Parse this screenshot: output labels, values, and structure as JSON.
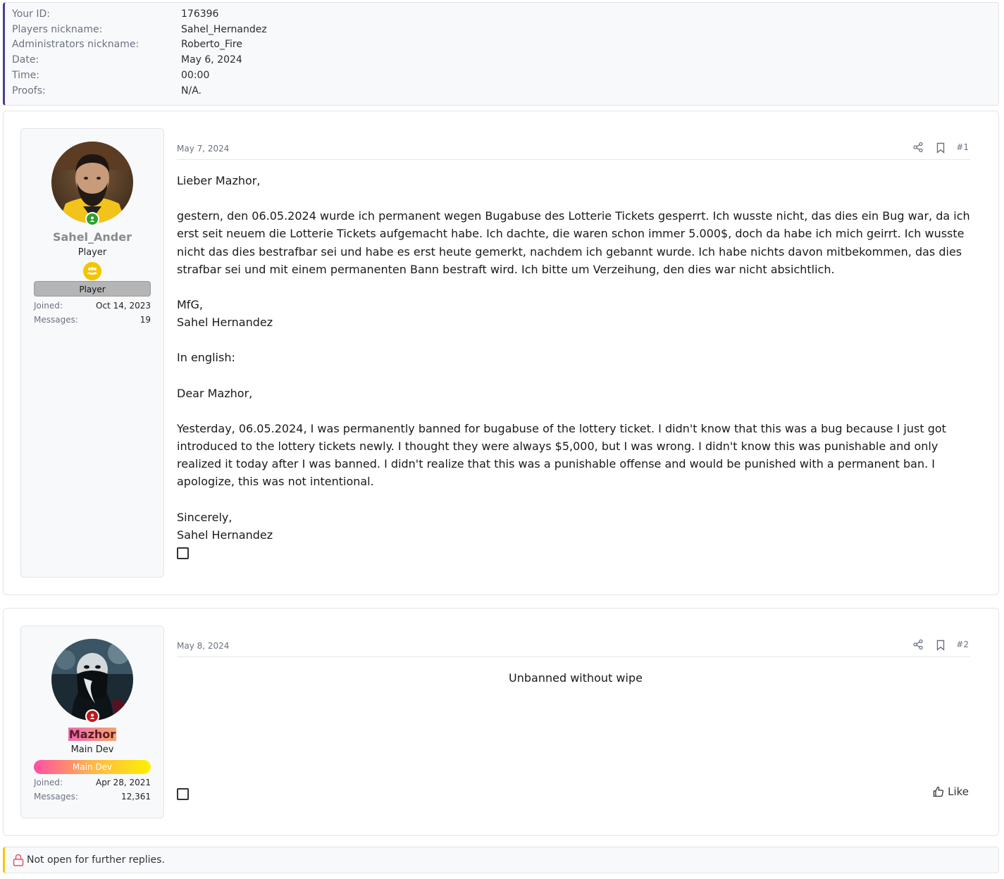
{
  "info": {
    "rows": [
      {
        "label": "Your ID:",
        "value": "176396"
      },
      {
        "label": "Players nickname:",
        "value": "Sahel_Hernandez"
      },
      {
        "label": "Administrators nickname:",
        "value": "Roberto_Fire"
      },
      {
        "label": "Date:",
        "value": "May 6, 2024"
      },
      {
        "label": "Time:",
        "value": "00:00"
      },
      {
        "label": "Proofs:",
        "value": "N/A."
      }
    ]
  },
  "posts": [
    {
      "username": "Sahel_Ander",
      "user_title": "Player",
      "banner": "Player",
      "joined_label": "Joined:",
      "joined": "Oct 14, 2023",
      "messages_label": "Messages:",
      "messages": "19",
      "date": "May 7, 2024",
      "number": "#1",
      "body": [
        "Lieber Mazhor,",
        "gestern, den 06.05.2024 wurde ich permanent wegen Bugabuse des Lotterie Tickets gesperrt. Ich wusste nicht, das dies ein Bug war, da ich erst seit neuem die Lotterie Tickets aufgemacht habe. Ich dachte, die waren schon immer 5.000$, doch da habe ich mich geirrt. Ich wusste nicht das dies bestrafbar sei und habe es erst heute gemerkt, nachdem ich gebannt wurde. Ich habe nichts davon mitbekommen, das dies strafbar sei und mit einem permanenten Bann bestraft wird. Ich bitte um Verzeihung, den dies war nicht absichtlich.",
        "MfG,\nSahel Hernandez",
        "In english:",
        "Dear Mazhor,",
        "Yesterday, 06.05.2024, I was permanently banned for bugabuse of the lottery ticket. I didn't know that this was a bug because I just got introduced to the lottery tickets newly. I thought they were always $5,000, but I was wrong. I didn't know this was punishable and only realized it today after I was banned. I didn't realize that this was a punishable offense and would be punished with a permanent ban. I apologize, this was not intentional.",
        "Sincerely,\nSahel Hernandez"
      ]
    },
    {
      "username": "Mazhor",
      "user_title": "Main Dev",
      "banner": "Main Dev",
      "joined_label": "Joined:",
      "joined": "Apr 28, 2021",
      "messages_label": "Messages:",
      "messages": "12,361",
      "date": "May 8, 2024",
      "number": "#2",
      "body_center": "Unbanned without wipe",
      "like_label": "Like"
    }
  ],
  "locked_notice": "Not open for further replies.",
  "icons": {
    "share": "share-icon",
    "bookmark": "bookmark-icon",
    "like": "thumbs-up-icon",
    "lock": "lock-icon",
    "player_badge": "group-badge-icon"
  },
  "colors": {
    "info_accent": "#4b3e8f",
    "locked_accent": "#f5c800",
    "online_status": "#2ca02c",
    "staff_status": "#c0161c"
  }
}
